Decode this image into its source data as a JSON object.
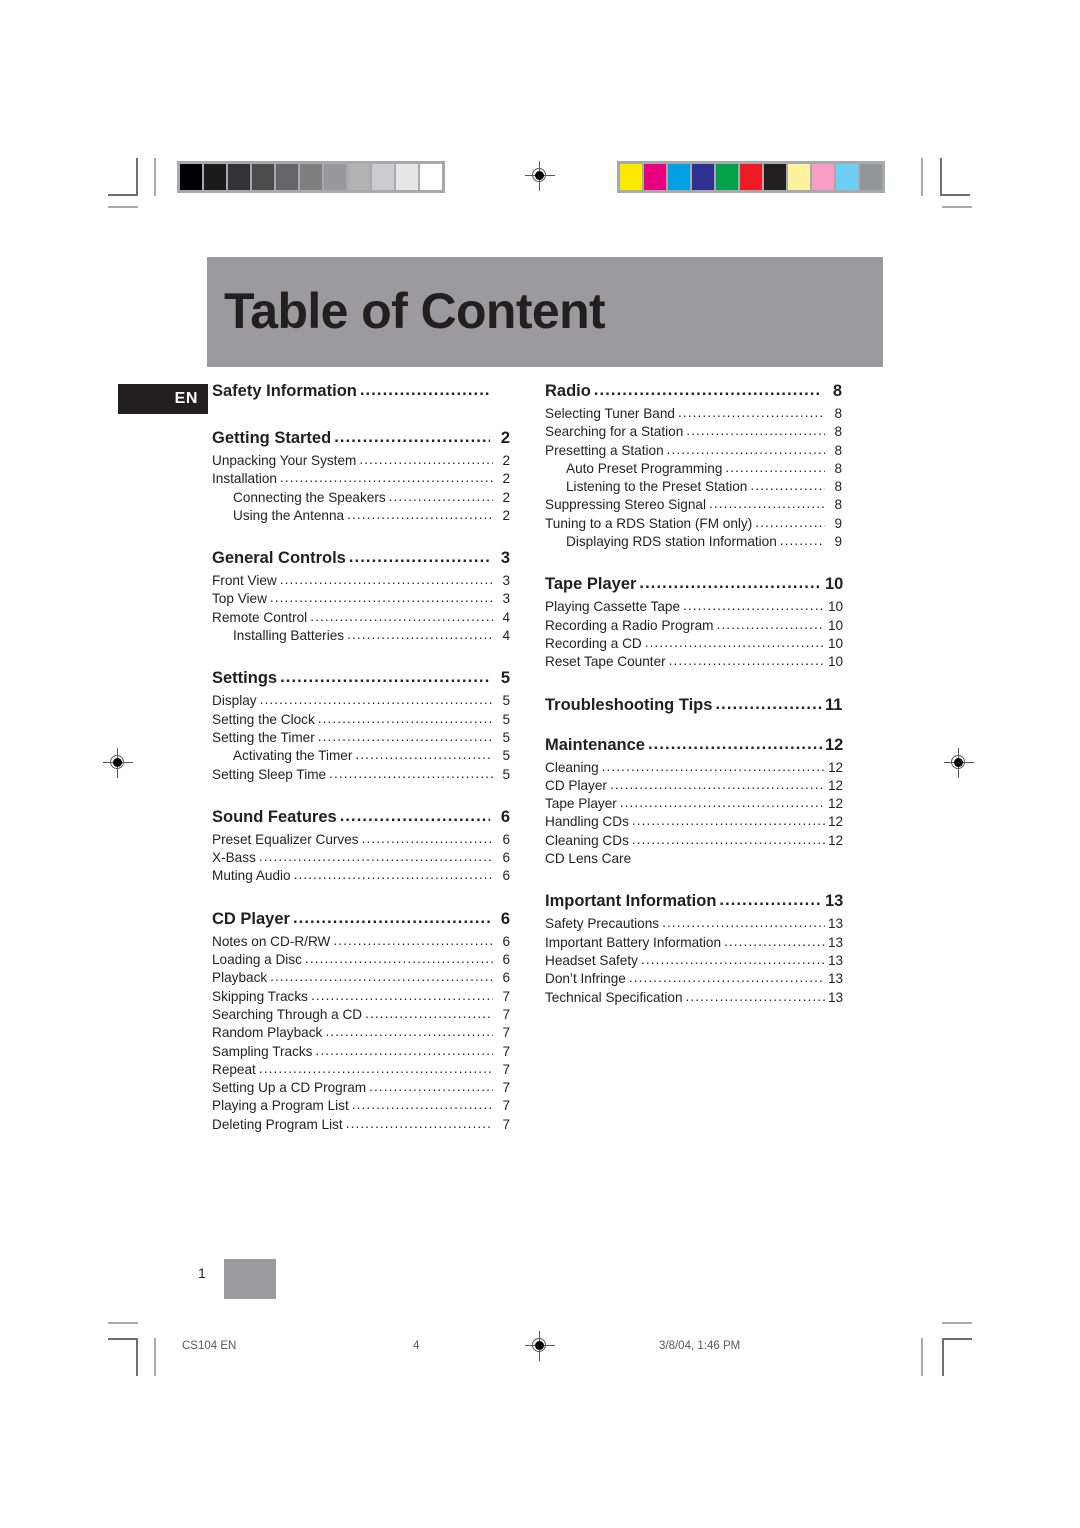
{
  "document": {
    "title": "Table of Content",
    "language_badge": "EN",
    "folio": "1"
  },
  "calibration": {
    "grayscale_bar": [
      "#000000",
      "#1c1c1c",
      "#333333",
      "#4c4c4c",
      "#666666",
      "#7f7f7f",
      "#999999",
      "#b2b2b2",
      "#cccccc",
      "#e6e6e6",
      "#ffffff"
    ],
    "color_bar": [
      "#ffe900",
      "#e6007e",
      "#00a0e3",
      "#2e3192",
      "#00a14b",
      "#ed1c24",
      "#231f20",
      "#fdf2a0",
      "#f89ec4",
      "#6dcff6",
      "#939598"
    ],
    "frame_color": "#a7a9ac"
  },
  "columns": {
    "left": [
      {
        "type": "heading",
        "label": "Safety Information",
        "page": "",
        "leaders": false
      },
      {
        "type": "gap",
        "size": "lg"
      },
      {
        "type": "heading",
        "label": "Getting Started",
        "page": "2",
        "leaders": true
      },
      {
        "type": "entry",
        "label": "Unpacking Your System",
        "page": "2",
        "indent": 0
      },
      {
        "type": "entry",
        "label": "Installation",
        "page": "2",
        "indent": 0
      },
      {
        "type": "entry",
        "label": "Connecting the Speakers",
        "page": "2",
        "indent": 1
      },
      {
        "type": "entry",
        "label": "Using the Antenna",
        "page": "2",
        "indent": 1
      },
      {
        "type": "gap",
        "size": "lg"
      },
      {
        "type": "heading",
        "label": "General Controls",
        "page": "3",
        "leaders": true
      },
      {
        "type": "entry",
        "label": "Front View",
        "page": "3",
        "indent": 0
      },
      {
        "type": "entry",
        "label": "Top View",
        "page": "3",
        "indent": 0
      },
      {
        "type": "entry",
        "label": "Remote Control",
        "page": "4",
        "indent": 0
      },
      {
        "type": "entry",
        "label": "Installing Batteries",
        "page": "4",
        "indent": 1
      },
      {
        "type": "gap",
        "size": "lg"
      },
      {
        "type": "heading",
        "label": "Settings",
        "page": "5",
        "leaders": true
      },
      {
        "type": "entry",
        "label": "Display",
        "page": "5",
        "indent": 0
      },
      {
        "type": "entry",
        "label": "Setting the Clock",
        "page": "5",
        "indent": 0
      },
      {
        "type": "entry",
        "label": "Setting the Timer",
        "page": "5",
        "indent": 0
      },
      {
        "type": "entry",
        "label": "Activating the Timer",
        "page": "5",
        "indent": 1
      },
      {
        "type": "entry",
        "label": "Setting Sleep Time",
        "page": "5",
        "indent": 0
      },
      {
        "type": "gap",
        "size": "lg"
      },
      {
        "type": "heading",
        "label": "Sound Features",
        "page": "6",
        "leaders": true
      },
      {
        "type": "entry",
        "label": "Preset Equalizer Curves",
        "page": "6",
        "indent": 0
      },
      {
        "type": "entry",
        "label": "X-Bass",
        "page": "6",
        "indent": 0
      },
      {
        "type": "entry",
        "label": "Muting Audio",
        "page": "6",
        "indent": 0
      },
      {
        "type": "gap",
        "size": "lg"
      },
      {
        "type": "heading",
        "label": "CD Player",
        "page": "6",
        "leaders": true
      },
      {
        "type": "entry",
        "label": "Notes on CD-R/RW",
        "page": "6",
        "indent": 0
      },
      {
        "type": "entry",
        "label": "Loading a Disc",
        "page": "6",
        "indent": 0
      },
      {
        "type": "entry",
        "label": "Playback",
        "page": "6",
        "indent": 0
      },
      {
        "type": "entry",
        "label": "Skipping Tracks",
        "page": "7",
        "indent": 0
      },
      {
        "type": "entry",
        "label": "Searching Through a CD",
        "page": "7",
        "indent": 0
      },
      {
        "type": "entry",
        "label": "Random Playback",
        "page": "7",
        "indent": 0
      },
      {
        "type": "entry",
        "label": "Sampling Tracks",
        "page": "7",
        "indent": 0
      },
      {
        "type": "entry",
        "label": "Repeat",
        "page": "7",
        "indent": 0
      },
      {
        "type": "entry",
        "label": "Setting Up a CD Program",
        "page": "7",
        "indent": 0
      },
      {
        "type": "entry",
        "label": "Playing a Program List",
        "page": "7",
        "indent": 0
      },
      {
        "type": "entry",
        "label": "Deleting Program List",
        "page": "7",
        "indent": 0
      }
    ],
    "right": [
      {
        "type": "heading",
        "label": "Radio",
        "page": "8",
        "leaders": true
      },
      {
        "type": "entry",
        "label": "Selecting Tuner Band",
        "page": "8",
        "indent": 0
      },
      {
        "type": "entry",
        "label": "Searching for a Station",
        "page": "8",
        "indent": 0
      },
      {
        "type": "entry",
        "label": "Presetting a Station",
        "page": "8",
        "indent": 0
      },
      {
        "type": "entry",
        "label": "Auto Preset Programming",
        "page": "8",
        "indent": 1
      },
      {
        "type": "entry",
        "label": "Listening to the Preset Station",
        "page": "8",
        "indent": 1
      },
      {
        "type": "entry",
        "label": "Suppressing Stereo Signal",
        "page": "8",
        "indent": 0
      },
      {
        "type": "entry",
        "label": "Tuning to a RDS Station (FM only)",
        "page": "9",
        "indent": 0
      },
      {
        "type": "entry",
        "label": "Displaying RDS station Information",
        "page": "9",
        "indent": 1
      },
      {
        "type": "gap",
        "size": "lg"
      },
      {
        "type": "heading",
        "label": "Tape Player",
        "page": "10",
        "leaders": true
      },
      {
        "type": "entry",
        "label": "Playing Cassette Tape",
        "page": "10",
        "indent": 0
      },
      {
        "type": "entry",
        "label": "Recording a Radio Program",
        "page": "10",
        "indent": 0
      },
      {
        "type": "entry",
        "label": "Recording a CD",
        "page": "10",
        "indent": 0
      },
      {
        "type": "entry",
        "label": "Reset Tape Counter",
        "page": "10",
        "indent": 0
      },
      {
        "type": "gap",
        "size": "lg"
      },
      {
        "type": "heading",
        "label": "Troubleshooting Tips",
        "page": "11",
        "leaders": true
      },
      {
        "type": "gap",
        "size": "md"
      },
      {
        "type": "heading",
        "label": "Maintenance",
        "page": "12",
        "leaders": true
      },
      {
        "type": "entry",
        "label": "Cleaning",
        "page": "12",
        "indent": 0
      },
      {
        "type": "entry",
        "label": "CD Player",
        "page": "12",
        "indent": 0
      },
      {
        "type": "entry",
        "label": "Tape Player",
        "page": "12",
        "indent": 0
      },
      {
        "type": "entry",
        "label": "Handling CDs",
        "page": "12",
        "indent": 0
      },
      {
        "type": "entry",
        "label": "Cleaning CDs",
        "page": "12",
        "indent": 0
      },
      {
        "type": "entry",
        "label": "CD Lens Care",
        "page": "",
        "indent": 0,
        "leaders": false
      },
      {
        "type": "gap",
        "size": "lg"
      },
      {
        "type": "heading",
        "label": "Important Information",
        "page": "13",
        "leaders": true
      },
      {
        "type": "entry",
        "label": "Safety Precautions",
        "page": "13",
        "indent": 0
      },
      {
        "type": "entry",
        "label": "Important Battery Information",
        "page": "13",
        "indent": 0
      },
      {
        "type": "entry",
        "label": "Headset Safety",
        "page": "13",
        "indent": 0
      },
      {
        "type": "entry",
        "label": "Don’t Infringe",
        "page": "13",
        "indent": 0
      },
      {
        "type": "entry",
        "label": "Technical Specification",
        "page": "13",
        "indent": 0
      }
    ]
  },
  "slug": {
    "file_name": "CS104 EN",
    "sheet_number": "4",
    "timestamp": "3/8/04, 1:46 PM"
  }
}
